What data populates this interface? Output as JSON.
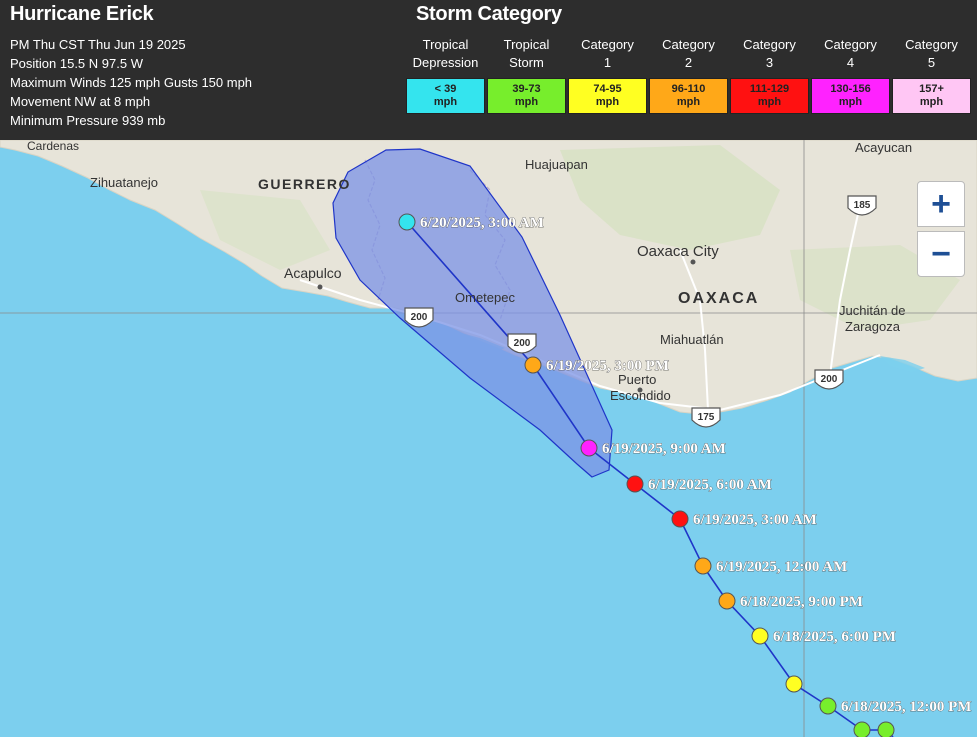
{
  "header": {
    "title": "Hurricane Erick",
    "info": [
      "PM Thu CST Thu Jun 19 2025",
      "Position 15.5 N 97.5 W",
      "Maximum Winds 125 mph Gusts 150 mph",
      "Movement NW at 8 mph",
      "Minimum Pressure 939 mb"
    ]
  },
  "legend": {
    "title": "Storm Category",
    "categories": [
      {
        "l1": "Tropical",
        "l2": "Depression",
        "r1": "< 39",
        "r2": "mph",
        "color": "#34e4ee"
      },
      {
        "l1": "Tropical",
        "l2": "Storm",
        "r1": "39-73",
        "r2": "mph",
        "color": "#77ee2c"
      },
      {
        "l1": "Category",
        "l2": "1",
        "r1": "74-95",
        "r2": "mph",
        "color": "#ffff22"
      },
      {
        "l1": "Category",
        "l2": "2",
        "r1": "96-110",
        "r2": "mph",
        "color": "#ffa818"
      },
      {
        "l1": "Category",
        "l2": "3",
        "r1": "111-129",
        "r2": "mph",
        "color": "#ff1111"
      },
      {
        "l1": "Category",
        "l2": "4",
        "r1": "130-156",
        "r2": "mph",
        "color": "#ff22ff"
      },
      {
        "l1": "Category",
        "l2": "5",
        "r1": "157+",
        "r2": "mph",
        "color": "#ffc6f4"
      }
    ]
  },
  "map": {
    "places": {
      "cardenas": "Cardenas",
      "zihuatanejo": "Zihuatanejo",
      "guerrero": "GUERRERO",
      "acapulco": "Acapulco",
      "huajuapan": "Huajuapan",
      "oaxaca_city": "Oaxaca City",
      "oaxaca": "OAXACA",
      "ometepec": "Ometepec",
      "miahuatlan": "Miahuatlán",
      "puerto": "Puerto",
      "escondido": "Escondido",
      "acayucan": "Acayucan",
      "juchitan": "Juchitán de",
      "zaragoza": "Zaragoza"
    },
    "shields": {
      "r185": "185",
      "r200a": "200",
      "r200b": "200",
      "r200c": "200",
      "r175": "175"
    },
    "zoom_in": "+",
    "zoom_out": "−"
  },
  "track": [
    {
      "label": "6/20/2025, 3:00 AM",
      "cat": 0
    },
    {
      "label": "6/19/2025, 3:00 PM",
      "cat": 3
    },
    {
      "label": "6/19/2025, 9:00 AM",
      "cat": 5
    },
    {
      "label": "6/19/2025, 6:00 AM",
      "cat": 4
    },
    {
      "label": "6/19/2025, 3:00 AM",
      "cat": 4
    },
    {
      "label": "6/19/2025, 12:00 AM",
      "cat": 3
    },
    {
      "label": "6/18/2025, 9:00 PM",
      "cat": 3
    },
    {
      "label": "6/18/2025, 6:00 PM",
      "cat": 2
    },
    {
      "label": "",
      "cat": 2
    },
    {
      "label": "6/18/2025, 12:00 PM",
      "cat": 1
    },
    {
      "label": "",
      "cat": 1
    },
    {
      "label": "",
      "cat": 1
    }
  ]
}
